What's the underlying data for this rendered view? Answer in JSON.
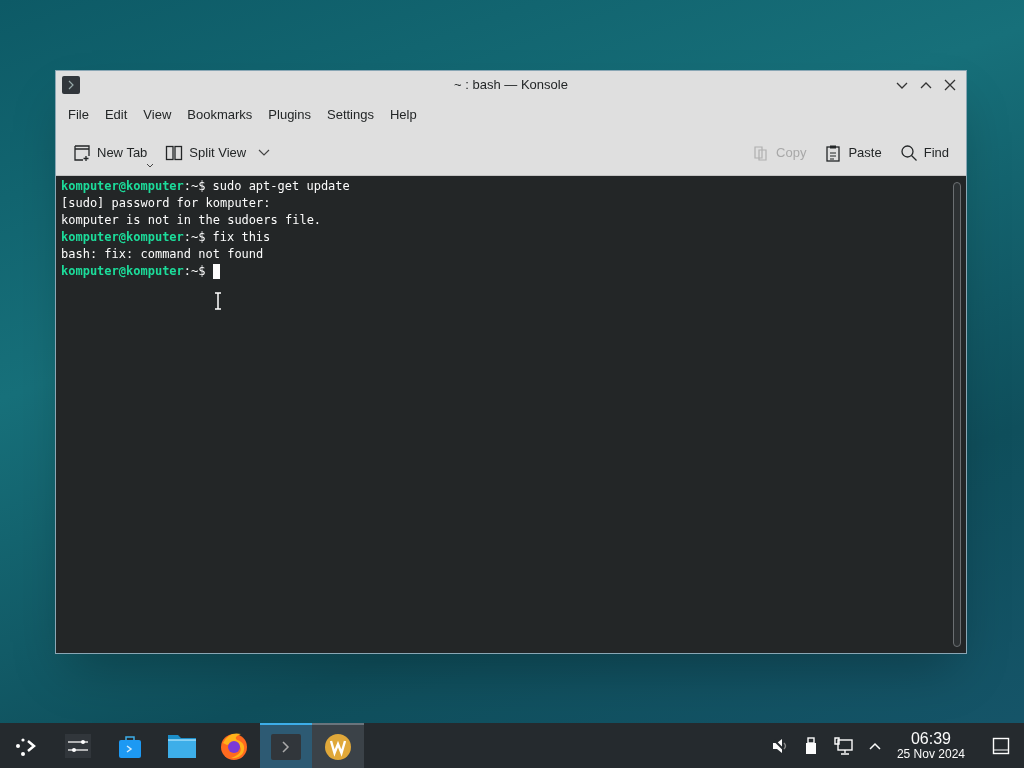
{
  "window": {
    "title": "~ : bash — Konsole"
  },
  "menu": [
    "File",
    "Edit",
    "View",
    "Bookmarks",
    "Plugins",
    "Settings",
    "Help"
  ],
  "toolbar": [
    {
      "kind": "newtab",
      "label": "New Tab",
      "disabled": false
    },
    {
      "kind": "split",
      "label": "Split View",
      "disabled": false
    },
    {
      "kind": "copy",
      "label": "Copy",
      "disabled": true
    },
    {
      "kind": "paste",
      "label": "Paste",
      "disabled": false
    },
    {
      "kind": "find",
      "label": "Find",
      "disabled": false
    }
  ],
  "terminal": {
    "lines": [
      {
        "kind": "prompt",
        "user": "komputer@komputer",
        "path": ":~$",
        "command": "sudo apt-get update"
      },
      {
        "kind": "output",
        "text": "[sudo] password for komputer:"
      },
      {
        "kind": "output",
        "text": "komputer is not in the sudoers file."
      },
      {
        "kind": "prompt",
        "user": "komputer@komputer",
        "path": ":~$",
        "command": "fix this"
      },
      {
        "kind": "output",
        "text": "bash: fix: command not found"
      },
      {
        "kind": "prompt",
        "user": "komputer@komputer",
        "path": ":~$",
        "cursor": true
      }
    ]
  },
  "taskbar": {
    "apps": [
      {
        "kind": "launcher",
        "selected": false,
        "hovered": false
      },
      {
        "kind": "settings",
        "selected": false,
        "hovered": false
      },
      {
        "kind": "store",
        "selected": false,
        "hovered": false
      },
      {
        "kind": "files",
        "selected": false,
        "hovered": false
      },
      {
        "kind": "browser",
        "selected": false,
        "hovered": false
      },
      {
        "kind": "terminal",
        "selected": true,
        "hovered": false
      },
      {
        "kind": "wiki",
        "selected": false,
        "hovered": true
      }
    ],
    "clock": {
      "time": "06:39",
      "date": "25 Nov 2024"
    }
  }
}
